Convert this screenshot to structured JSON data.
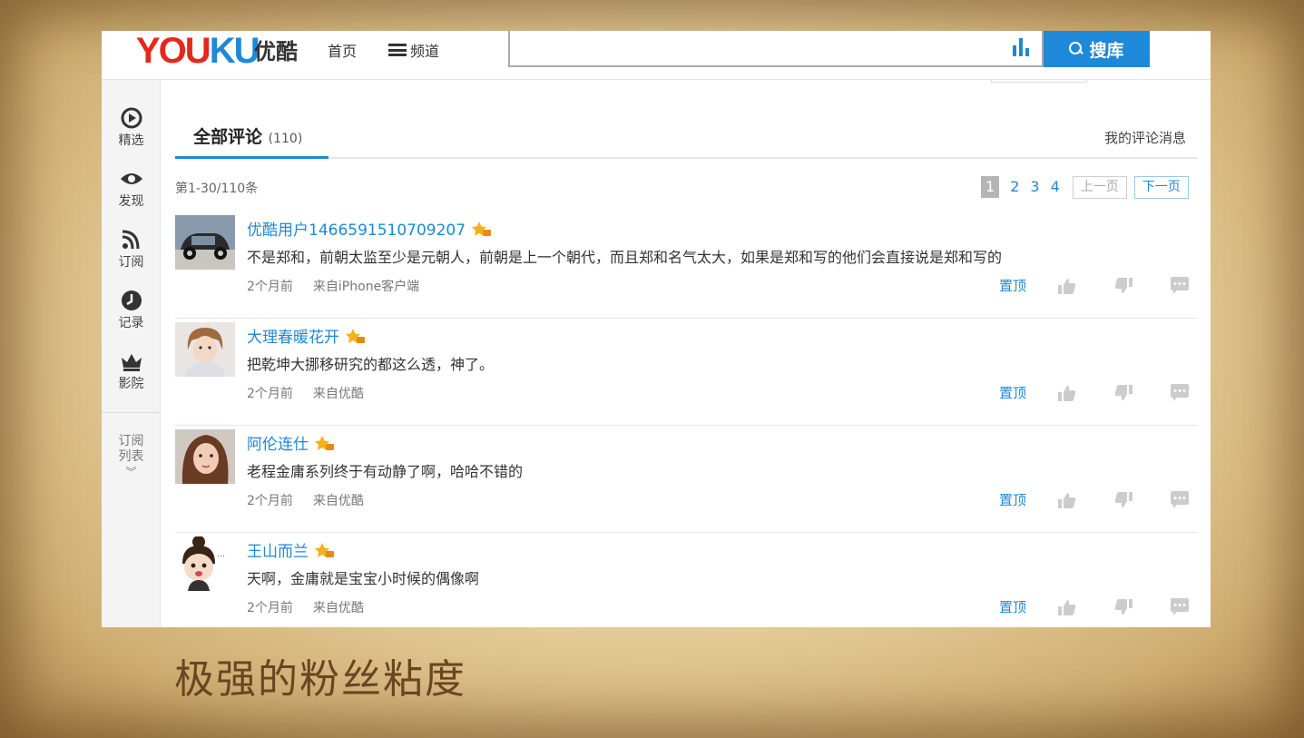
{
  "header": {
    "logo_latin_a": "YOU",
    "logo_latin_b": "KU",
    "logo_cn": "优酷",
    "nav_home": "首页",
    "nav_channel": "频道",
    "search_placeholder": "",
    "search_button": "搜库"
  },
  "sidebar": {
    "items": [
      {
        "label": "精选",
        "icon": "play-circle-icon"
      },
      {
        "label": "发现",
        "icon": "eye-icon"
      },
      {
        "label": "订阅",
        "icon": "rss-icon"
      },
      {
        "label": "记录",
        "icon": "clock-icon"
      },
      {
        "label": "影院",
        "icon": "crown-icon"
      }
    ],
    "sub_line1": "订阅",
    "sub_line2": "列表",
    "sub_chevron": "︾"
  },
  "comments_panel": {
    "tab_label": "全部评论",
    "tab_count": "(110)",
    "my_messages": "我的评论消息",
    "range_text": "第1-30/110条",
    "pager": {
      "pages": [
        "1",
        "2",
        "3",
        "4"
      ],
      "current": "1",
      "prev": "上一页",
      "next": "下一页"
    },
    "pin_label": "置顶",
    "comments": [
      {
        "user": "优酷用户1466591510709207",
        "text": "不是郑和，前朝太监至少是元朝人，前朝是上一个朝代，而且郑和名气太大，如果是郑和写的他们会直接说是郑和写的",
        "time": "2个月前",
        "source": "来自iPhone客户端"
      },
      {
        "user": "大理春暖花开",
        "text": "把乾坤大挪移研究的都这么透，神了。",
        "time": "2个月前",
        "source": "来自优酷"
      },
      {
        "user": "阿伦连仕",
        "text": "老程金庸系列终于有动静了啊，哈哈不错的",
        "time": "2个月前",
        "source": "来自优酷"
      },
      {
        "user": "王山而兰",
        "text": "天啊，金庸就是宝宝小时候的偶像啊",
        "time": "2个月前",
        "source": "来自优酷"
      }
    ]
  },
  "slide_caption": "极强的粉丝粘度",
  "colors": {
    "accent": "#1e88d9",
    "logo_red": "#e5281c",
    "caption_brown": "#6a4522"
  }
}
